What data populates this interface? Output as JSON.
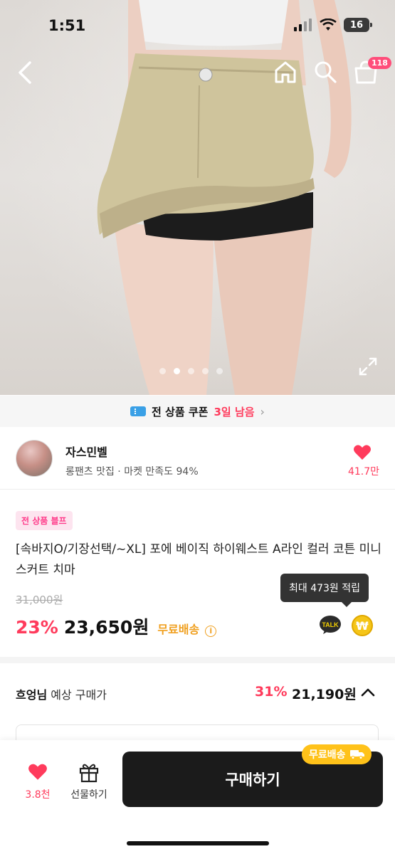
{
  "status_bar": {
    "time": "1:51",
    "battery": "16"
  },
  "header": {
    "cart_count": "118"
  },
  "coupon_bar": {
    "text": "전 상품 쿠폰",
    "remaining": "3일 남음"
  },
  "shop": {
    "name": "자스민벨",
    "description": "롱팬츠 맛집 · 마켓 만족도 94%",
    "likes": "41.7만"
  },
  "product": {
    "badge": "전 상품 블프",
    "title": "[속바지O/기장선택/~XL] 포에 베이직 하이웨스트 A라인 컬러 코튼 미니 스커트 치마",
    "original_price": "31,000원",
    "discount_rate": "23%",
    "price": "23,650원",
    "shipping": "무료배송",
    "points_tooltip": "최대 473원 적립",
    "talk_label": "TALK",
    "points_symbol": "₩"
  },
  "expected_price": {
    "user": "흐엉님",
    "label": " 예상 구매가",
    "discount_rate": "31%",
    "price": "21,190원"
  },
  "bottom_bar": {
    "like_count": "3.8천",
    "gift_label": "선물하기",
    "buy_label": "구매하기",
    "free_shipping": "무료배송"
  },
  "colors": {
    "accent": "#ff3b5c",
    "shipping": "#f0a020",
    "buy_button": "#1b1b1b"
  }
}
